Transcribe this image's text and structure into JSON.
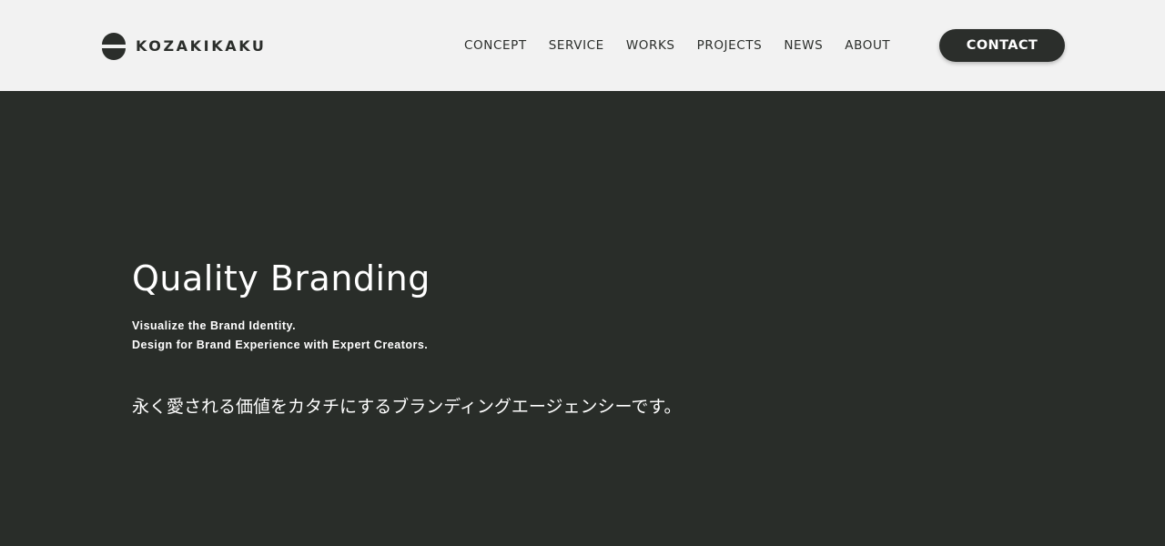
{
  "header": {
    "logo_text": "KOZAKIKAKU",
    "nav": [
      {
        "label": "CONCEPT"
      },
      {
        "label": "SERVICE"
      },
      {
        "label": "WORKS"
      },
      {
        "label": "PROJECTS"
      },
      {
        "label": "NEWS"
      },
      {
        "label": "ABOUT"
      }
    ],
    "contact_label": "CONTACT"
  },
  "hero": {
    "title": "Quality Branding",
    "subtitle_lines": [
      "Visualize the Brand Identity.",
      "Design for Brand Experience with Expert Creators."
    ],
    "tagline_jp": "永く愛される価値をカタチにするブランディングエージェンシーです。"
  },
  "colors": {
    "header_bg": "#f2f2f2",
    "hero_bg": "#292d29",
    "text_dark": "#2b2e2b",
    "text_light": "#ffffff"
  },
  "icons": {
    "logo_mark": "split-circle-logo-icon"
  }
}
